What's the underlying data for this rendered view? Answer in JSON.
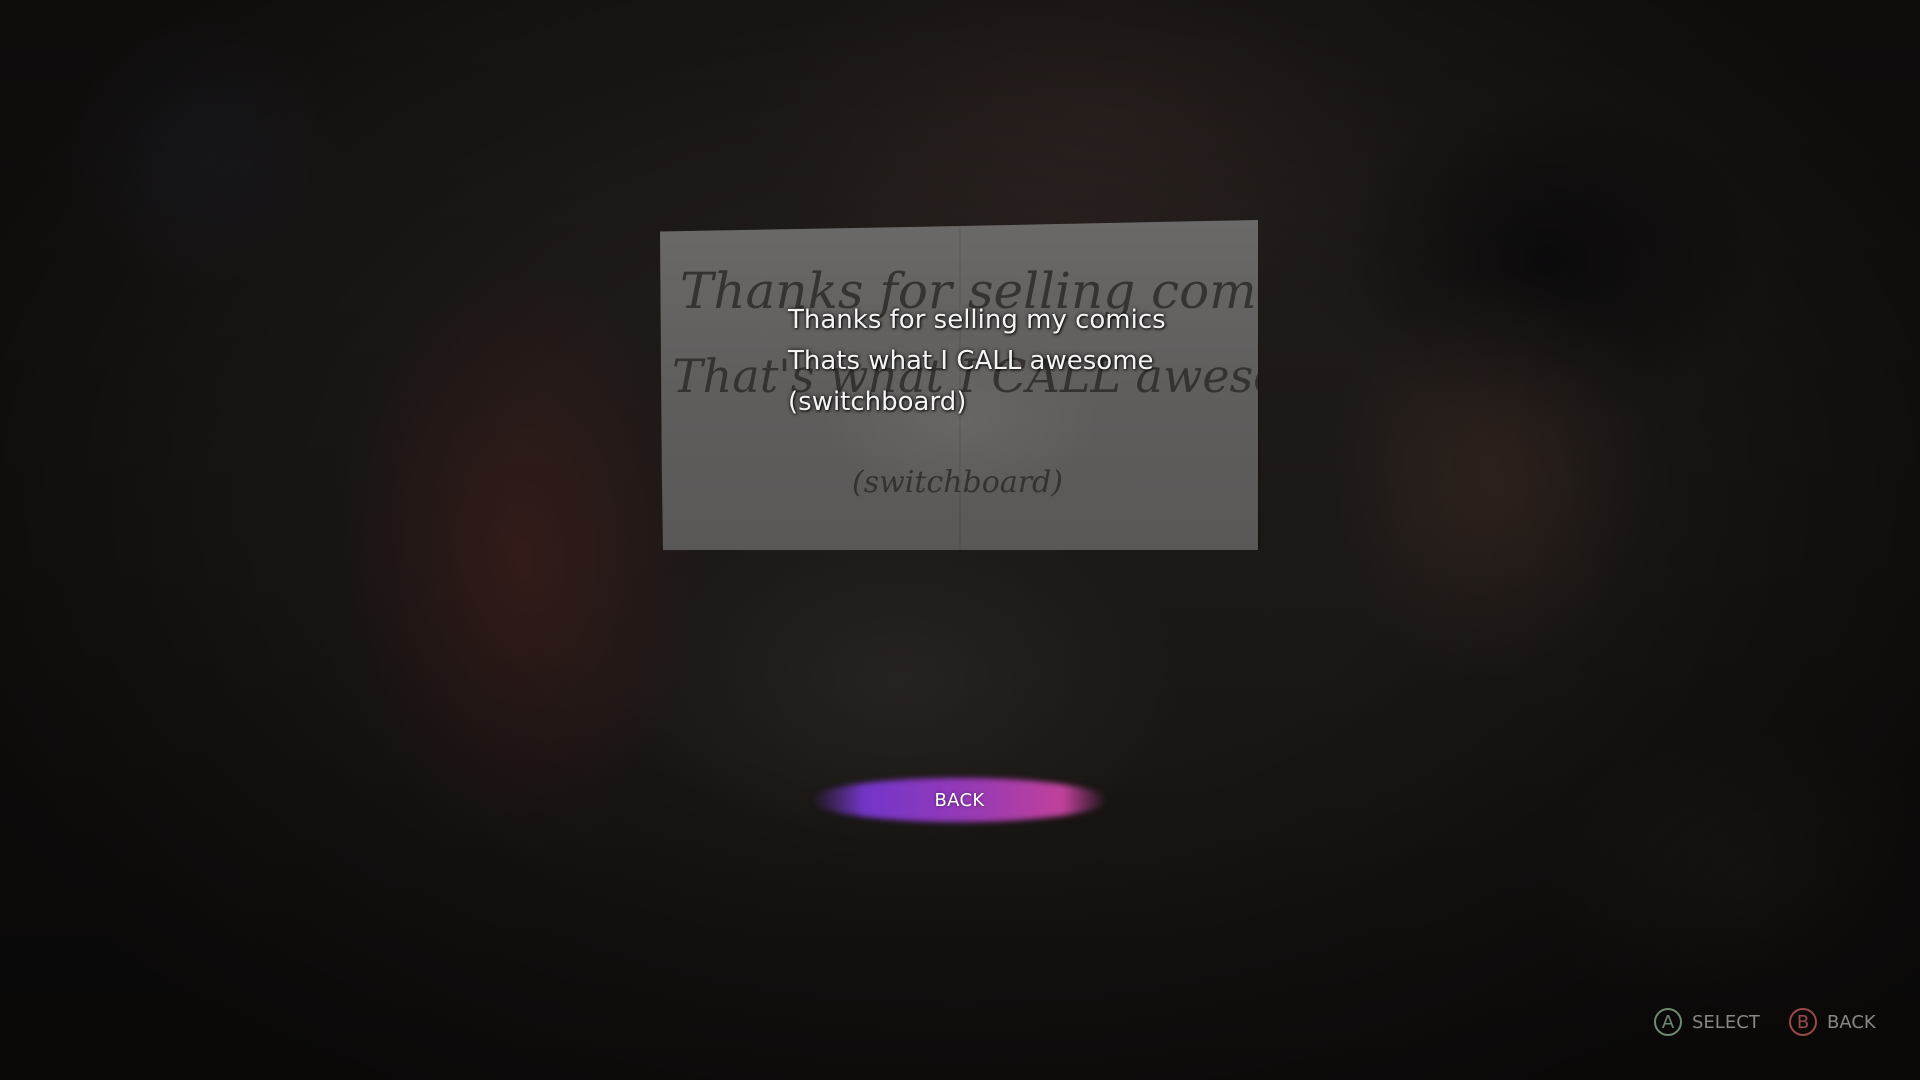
{
  "note": {
    "lines": [
      "Thanks for selling my comics",
      "Thats what I CALL awesome",
      "(switchboard)"
    ],
    "handwritten": {
      "line1": "Thanks for selling comics",
      "line2": "That's what I CALL awesome",
      "line3": "(switchboard)"
    }
  },
  "menu": {
    "back_label": "BACK",
    "highlight_color": "#a040d0"
  },
  "controls": {
    "select": {
      "button": "A",
      "label": "SELECT"
    },
    "back": {
      "button": "B",
      "label": "BACK"
    }
  }
}
